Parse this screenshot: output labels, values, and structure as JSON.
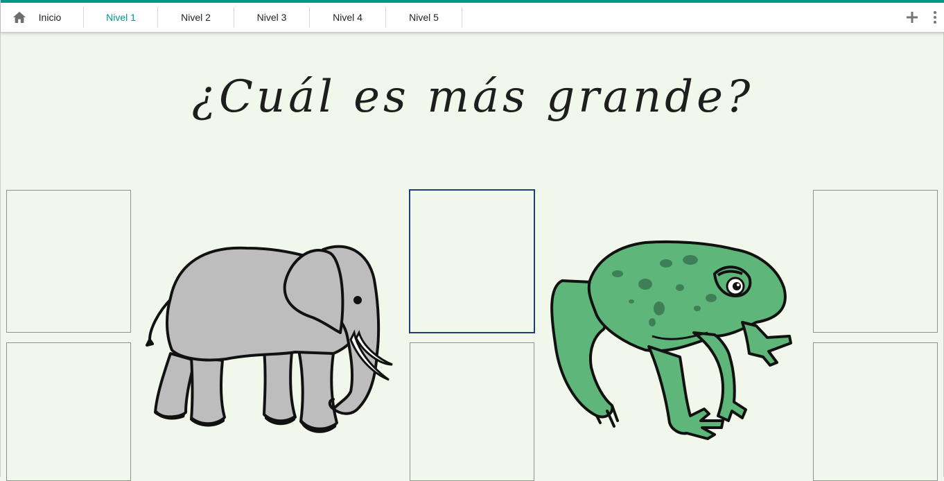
{
  "nav": {
    "home_label": "Inicio",
    "tabs": [
      {
        "label": "Nivel 1",
        "active": true
      },
      {
        "label": "Nivel 2",
        "active": false
      },
      {
        "label": "Nivel 3",
        "active": false
      },
      {
        "label": "Nivel 4",
        "active": false
      },
      {
        "label": "Nivel 5",
        "active": false
      }
    ],
    "icons": {
      "home": "home-icon",
      "add": "plus-icon",
      "more": "more-vert-icon"
    }
  },
  "activity": {
    "title": "¿Cuál es más grande?",
    "images": [
      {
        "name": "elephant",
        "icon": "elephant-picture"
      },
      {
        "name": "frog",
        "icon": "frog-picture"
      }
    ],
    "answer_slots": 6,
    "selected_slot": 3
  },
  "colors": {
    "accent": "#00968a",
    "background": "#f1f7ea",
    "selected_border": "#1d3d7a",
    "elephant": "#bdbdbd",
    "frog": "#5fb67a"
  }
}
